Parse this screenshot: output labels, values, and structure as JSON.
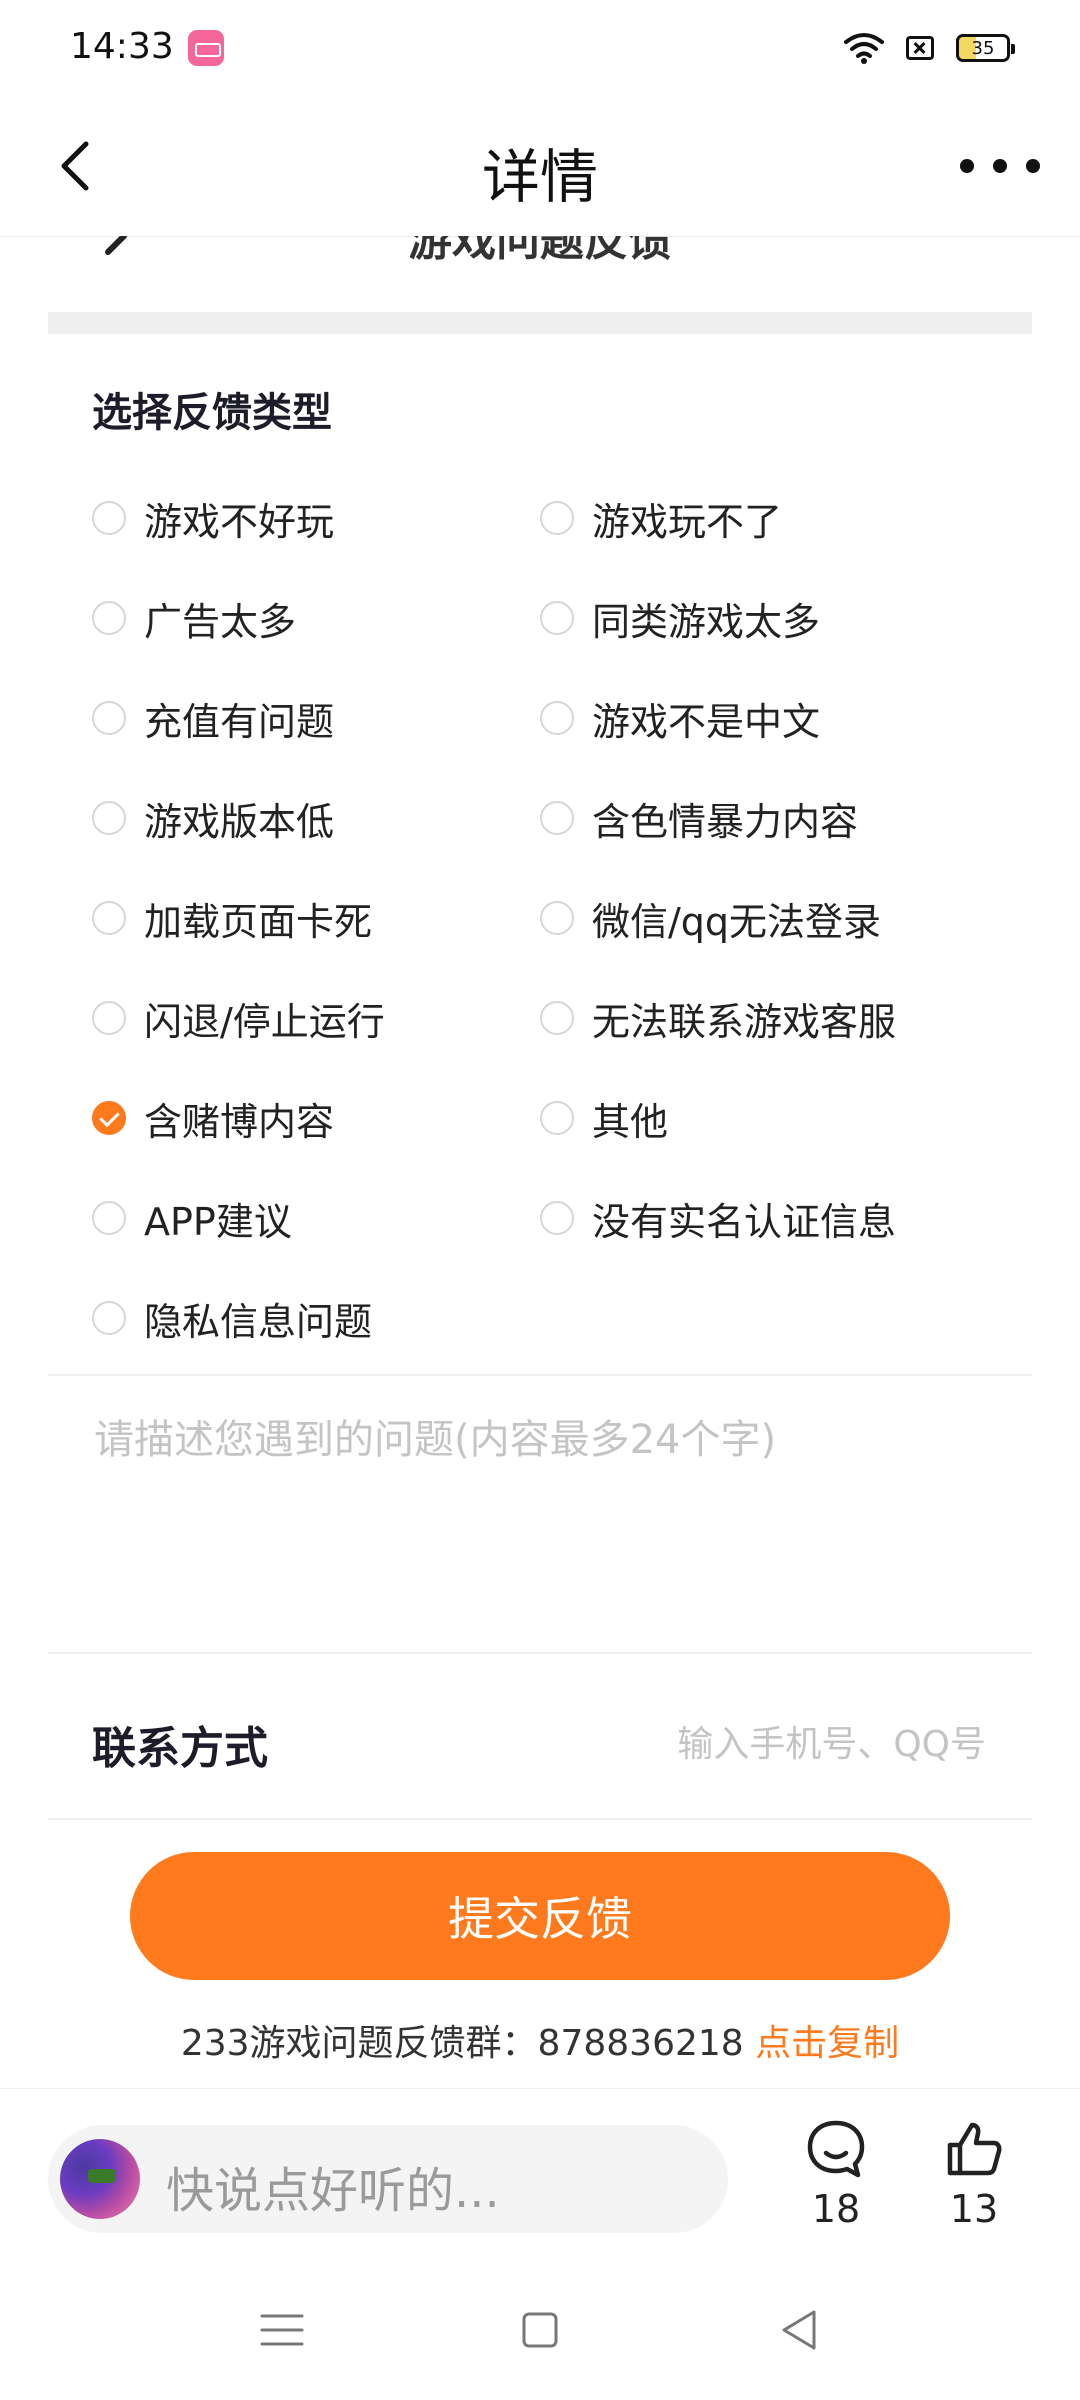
{
  "status_bar": {
    "time": "14:33",
    "battery": "35"
  },
  "header": {
    "title": "详情"
  },
  "sub_page": {
    "title": "游戏问题反馈"
  },
  "feedback": {
    "section_title": "选择反馈类型",
    "accent_color": "#ff7a1c",
    "options": [
      {
        "label": "游戏不好玩",
        "checked": false
      },
      {
        "label": "游戏玩不了",
        "checked": false
      },
      {
        "label": "广告太多",
        "checked": false
      },
      {
        "label": "同类游戏太多",
        "checked": false
      },
      {
        "label": "充值有问题",
        "checked": false
      },
      {
        "label": "游戏不是中文",
        "checked": false
      },
      {
        "label": "游戏版本低",
        "checked": false
      },
      {
        "label": "含色情暴力内容",
        "checked": false
      },
      {
        "label": "加载页面卡死",
        "checked": false
      },
      {
        "label": "微信/qq无法登录",
        "checked": false
      },
      {
        "label": "闪退/停止运行",
        "checked": false
      },
      {
        "label": "无法联系游戏客服",
        "checked": false
      },
      {
        "label": "含赌博内容",
        "checked": true
      },
      {
        "label": "其他",
        "checked": false
      },
      {
        "label": "APP建议",
        "checked": false
      },
      {
        "label": "没有实名认证信息",
        "checked": false
      },
      {
        "label": "隐私信息问题",
        "checked": false
      }
    ],
    "description_placeholder": "请描述您遇到的问题(内容最多24个字)",
    "contact_label": "联系方式",
    "contact_placeholder": "输入手机号、QQ号",
    "submit_label": "提交反馈",
    "group_text": "233游戏问题反馈群：878836218",
    "copy_label": "点击复制"
  },
  "bottom_bar": {
    "comment_placeholder": "快说点好听的...",
    "comment_count": "18",
    "like_count": "13"
  }
}
